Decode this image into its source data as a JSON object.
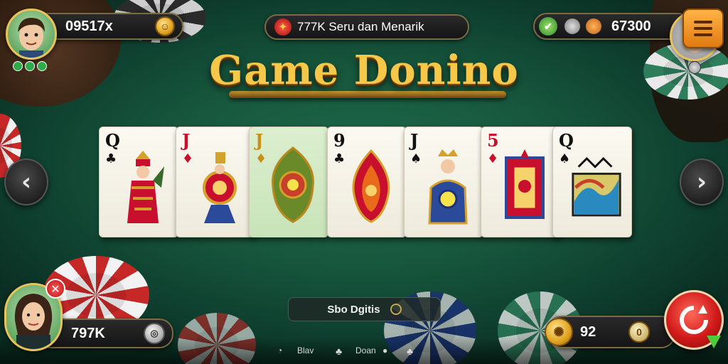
{
  "title": "Game Donino",
  "top_left": {
    "balance": "09517x"
  },
  "top_center": {
    "text": "777K Seru dan Menarik"
  },
  "top_right": {
    "balance": "67300"
  },
  "cards": [
    {
      "rank": "Q",
      "suit": "♣",
      "color": "black",
      "highlight": false,
      "art": "queen"
    },
    {
      "rank": "J",
      "suit": "♦",
      "color": "red",
      "highlight": false,
      "art": "knight"
    },
    {
      "rank": "J",
      "suit": "♦",
      "color": "gold",
      "highlight": true,
      "art": "ornament"
    },
    {
      "rank": "9",
      "suit": "♣",
      "color": "black",
      "highlight": false,
      "art": "flame"
    },
    {
      "rank": "J",
      "suit": "♠",
      "color": "black",
      "highlight": false,
      "art": "jack"
    },
    {
      "rank": "5",
      "suit": "♦",
      "color": "red",
      "highlight": false,
      "art": "tapestry"
    },
    {
      "rank": "Q",
      "suit": "♠",
      "color": "black",
      "highlight": false,
      "art": "wave"
    }
  ],
  "bottom_left": {
    "balance": "797K"
  },
  "status": {
    "label": "Sbo Dgitis"
  },
  "bottom_right": {
    "bet": "92"
  },
  "bottom_bar": {
    "item1": "Blav",
    "item2": "Doan"
  },
  "colors": {
    "accent": "#e8c25a",
    "felt": "#17573d",
    "button": "#d11a1a"
  }
}
